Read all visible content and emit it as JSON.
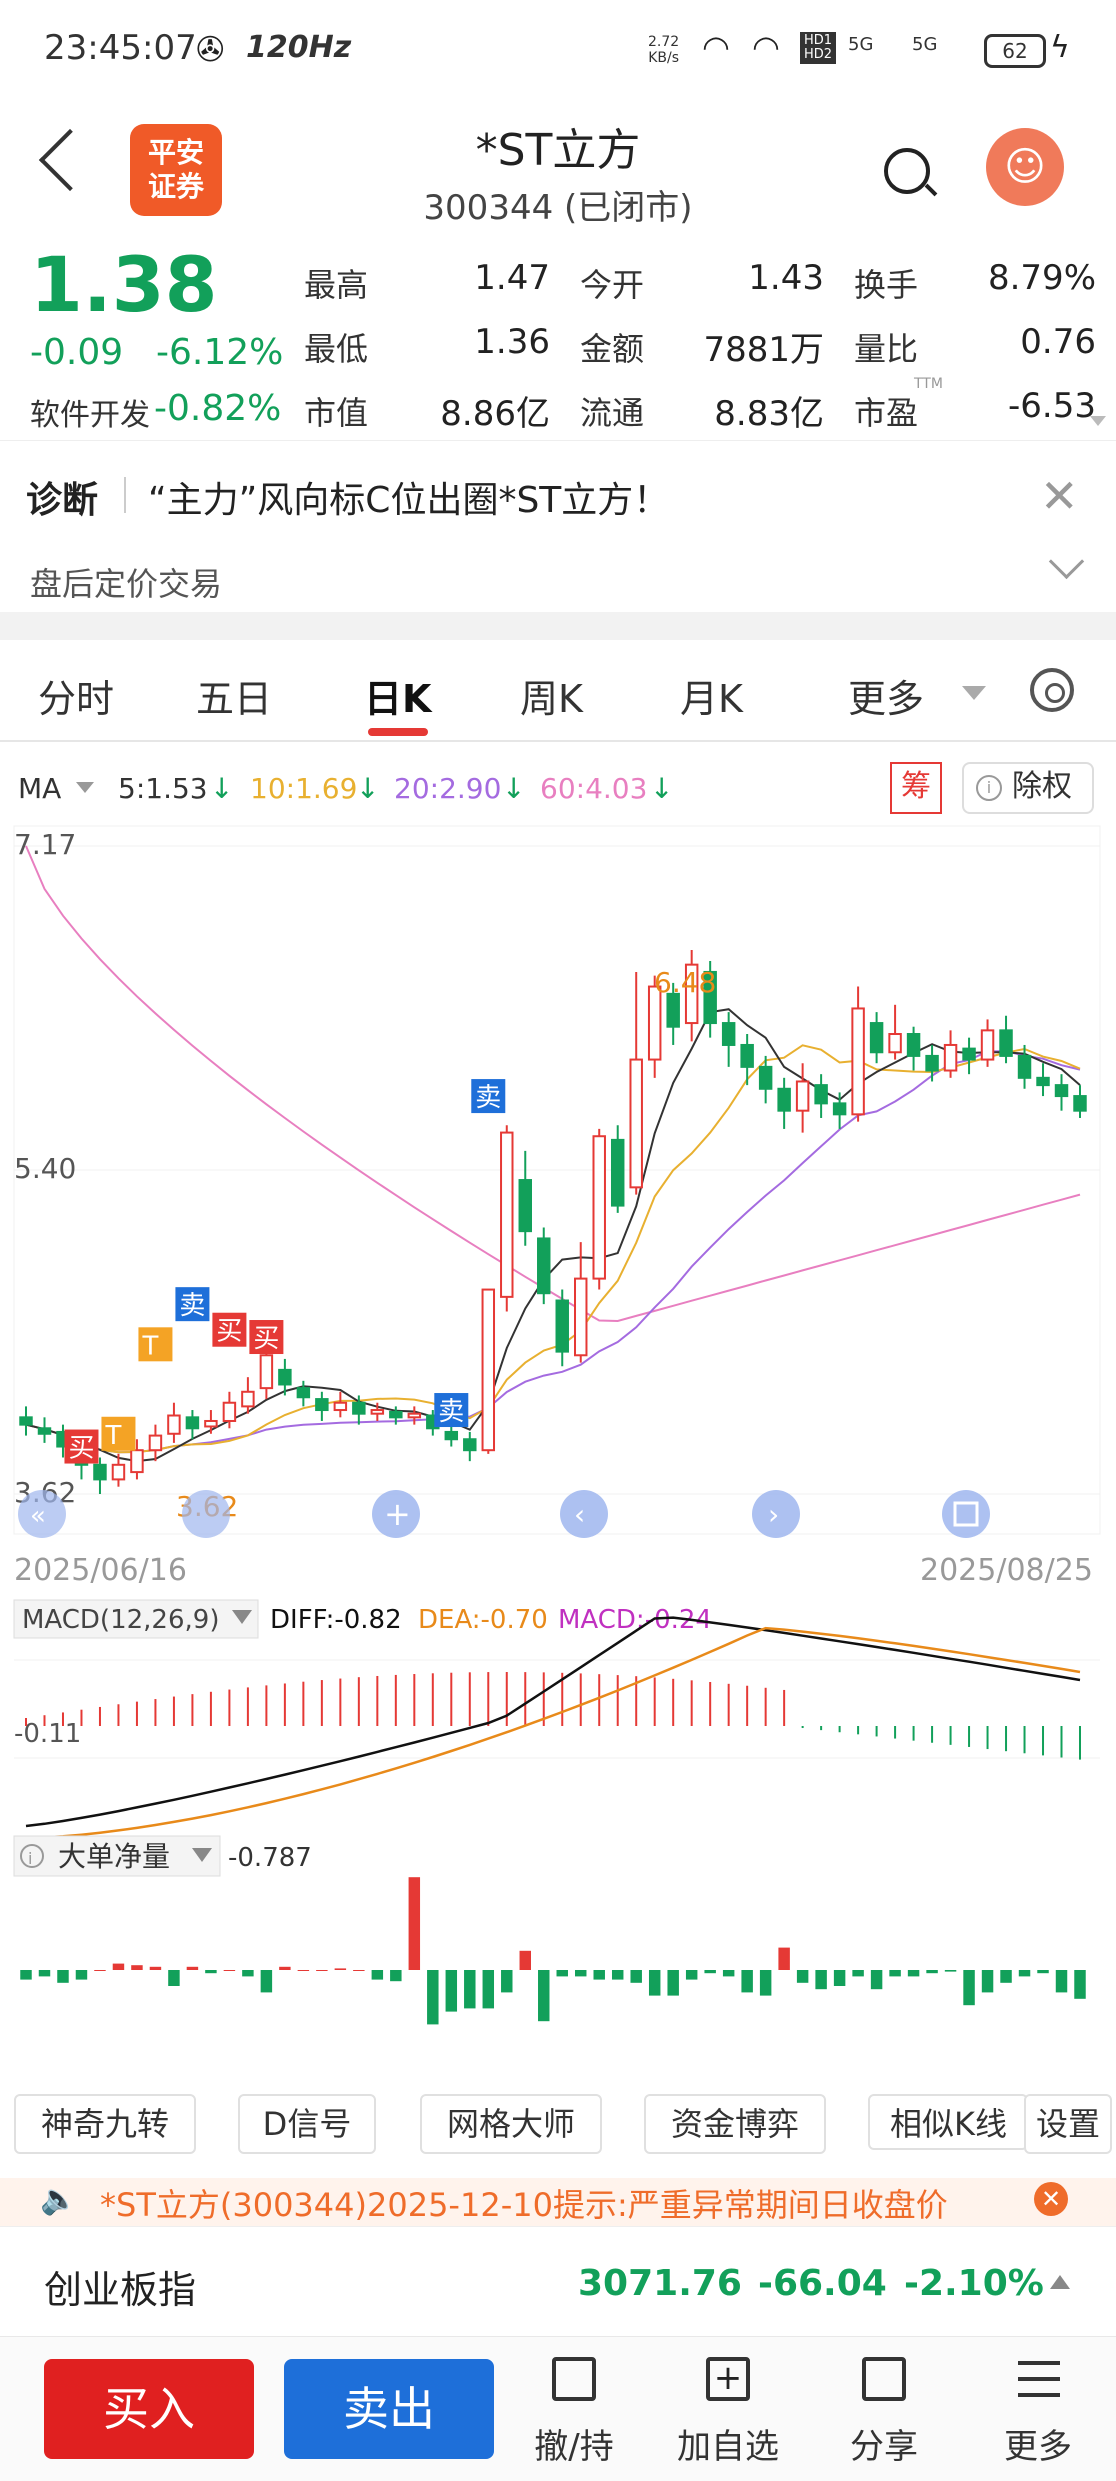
{
  "status_bar": {
    "time": "23:45:07",
    "refresh_rate": "120Hz",
    "net_speed": "2.72",
    "net_unit": "KB/s",
    "hd1": "HD1",
    "hd2": "HD2",
    "sig1": "5G",
    "sig2": "5G",
    "battery": "62"
  },
  "header": {
    "logo_line1": "平安",
    "logo_line2": "证券",
    "title": "*ST立方",
    "code": "300344 (已闭市)"
  },
  "quote": {
    "price": "1.38",
    "change": "-0.09",
    "change_pct": "-6.12%",
    "sector": "软件开发",
    "sector_pct": "-0.82%",
    "items": [
      {
        "label": "最高",
        "value": "1.47"
      },
      {
        "label": "今开",
        "value": "1.43"
      },
      {
        "label": "换手",
        "value": "8.79%"
      },
      {
        "label": "最低",
        "value": "1.36"
      },
      {
        "label": "金额",
        "value": "7881万"
      },
      {
        "label": "量比",
        "value": "0.76"
      },
      {
        "label": "市值",
        "value": "8.86亿"
      },
      {
        "label": "流通",
        "value": "8.83亿"
      },
      {
        "label": "市盈",
        "value": "-6.53"
      }
    ],
    "ttm": "TTM"
  },
  "diag": {
    "tag": "诊断",
    "text": "“主力”风向标C位出圈*ST立方！",
    "sub": "盘后定价交易"
  },
  "tabs": [
    "分时",
    "五日",
    "日K",
    "周K",
    "月K",
    "更多"
  ],
  "ma_legend": {
    "label": "MA",
    "ma5": "5:1.53",
    "ma10": "10:1.69",
    "ma20": "20:2.90",
    "ma60": "60:4.03",
    "chou": "筹",
    "chuquan": "除权"
  },
  "colors": {
    "up": "#e53935",
    "down": "#12a05a",
    "ma5": "#333333",
    "ma10": "#e8b030",
    "ma20": "#a46be0",
    "ma60": "#e87fc0",
    "buy": "#e53935",
    "sell": "#1e6fd9",
    "diff": "#111111",
    "dea": "#e88a1a",
    "macd": "#c030c0"
  },
  "kchart": {
    "y_high_label": "7.17",
    "y_mid_label": "5.40",
    "y_low_label": "3.62",
    "max_label": "6.48",
    "min_label": "3.62",
    "start_date": "2025/06/16",
    "end_date": "2025/08/25",
    "marks": {
      "buy": "买",
      "sell": "卖",
      "t": "T"
    }
  },
  "macd": {
    "label": "MACD(12,26,9)",
    "diff": "DIFF:-0.82",
    "dea": "DEA:-0.70",
    "macd": "MACD:-0.24",
    "axis": "-0.11"
  },
  "big_order": {
    "label": "大单净量",
    "value": "-0.787"
  },
  "tools": [
    "神奇九转",
    "D信号",
    "网格大师",
    "资金博弈",
    "相似K线",
    "设置"
  ],
  "notice": "*ST立方(300344)2025-12-10提示:严重异常期间日收盘价",
  "index": {
    "name": "创业板指",
    "value": "3071.76",
    "change": "-66.04",
    "pct": "-2.10%"
  },
  "bottom": {
    "buy": "买入",
    "sell": "卖出",
    "cancel": "撤/持",
    "add": "加自选",
    "share": "分享",
    "more": "更多"
  },
  "chart_data": {
    "type": "candlestick",
    "start": "2025/06/16",
    "end": "2025/08/25",
    "y_labels": [
      7.17,
      5.4,
      3.62
    ],
    "candles": [
      [
        4.04,
        4.0,
        4.1,
        3.94
      ],
      [
        3.98,
        3.95,
        4.04,
        3.9
      ],
      [
        3.96,
        3.88,
        4.0,
        3.82
      ],
      [
        3.85,
        3.78,
        3.9,
        3.7
      ],
      [
        3.78,
        3.7,
        3.82,
        3.62
      ],
      [
        3.7,
        3.78,
        3.84,
        3.66
      ],
      [
        3.74,
        3.86,
        3.92,
        3.7
      ],
      [
        3.86,
        3.94,
        4.0,
        3.8
      ],
      [
        3.95,
        4.05,
        4.12,
        3.9
      ],
      [
        4.04,
        3.98,
        4.08,
        3.92
      ],
      [
        3.99,
        4.02,
        4.08,
        3.95
      ],
      [
        4.02,
        4.12,
        4.18,
        3.98
      ],
      [
        4.1,
        4.18,
        4.26,
        4.06
      ],
      [
        4.2,
        4.38,
        4.45,
        4.14
      ],
      [
        4.3,
        4.22,
        4.36,
        4.16
      ],
      [
        4.2,
        4.15,
        4.24,
        4.1
      ],
      [
        4.14,
        4.08,
        4.18,
        4.02
      ],
      [
        4.08,
        4.12,
        4.18,
        4.04
      ],
      [
        4.12,
        4.06,
        4.16,
        4.0
      ],
      [
        4.06,
        4.08,
        4.12,
        4.02
      ],
      [
        4.07,
        4.04,
        4.1,
        4.0
      ],
      [
        4.04,
        4.06,
        4.1,
        4.0
      ],
      [
        4.05,
        3.98,
        4.08,
        3.94
      ],
      [
        3.96,
        3.92,
        4.0,
        3.88
      ],
      [
        3.92,
        3.86,
        3.96,
        3.8
      ],
      [
        3.86,
        4.74,
        4.74,
        3.84
      ],
      [
        4.7,
        5.6,
        5.64,
        4.62
      ],
      [
        5.34,
        5.06,
        5.5,
        4.98
      ],
      [
        5.02,
        4.72,
        5.08,
        4.66
      ],
      [
        4.68,
        4.4,
        4.74,
        4.32
      ],
      [
        4.38,
        4.8,
        5.0,
        4.34
      ],
      [
        4.8,
        5.58,
        5.62,
        4.74
      ],
      [
        5.56,
        5.2,
        5.64,
        5.16
      ],
      [
        5.3,
        6.0,
        6.48,
        5.26
      ],
      [
        6.0,
        6.4,
        6.46,
        5.9
      ],
      [
        6.36,
        6.18,
        6.42,
        6.08
      ],
      [
        6.2,
        6.52,
        6.6,
        6.1
      ],
      [
        6.48,
        6.2,
        6.54,
        6.12
      ],
      [
        6.2,
        6.08,
        6.26,
        5.96
      ],
      [
        6.08,
        5.96,
        6.14,
        5.86
      ],
      [
        5.96,
        5.84,
        6.02,
        5.76
      ],
      [
        5.84,
        5.72,
        5.9,
        5.62
      ],
      [
        5.72,
        5.88,
        5.98,
        5.6
      ],
      [
        5.86,
        5.76,
        5.92,
        5.68
      ],
      [
        5.76,
        5.7,
        5.82,
        5.62
      ],
      [
        5.7,
        6.28,
        6.4,
        5.66
      ],
      [
        6.2,
        6.04,
        6.26,
        5.98
      ],
      [
        6.04,
        6.14,
        6.3,
        6.0
      ],
      [
        6.14,
        6.02,
        6.18,
        5.94
      ],
      [
        6.02,
        5.94,
        6.08,
        5.88
      ],
      [
        5.94,
        6.08,
        6.16,
        5.9
      ],
      [
        6.06,
        6.0,
        6.12,
        5.92
      ],
      [
        6.0,
        6.16,
        6.22,
        5.96
      ],
      [
        6.16,
        6.02,
        6.24,
        5.98
      ],
      [
        6.02,
        5.9,
        6.08,
        5.84
      ],
      [
        5.9,
        5.86,
        5.98,
        5.8
      ],
      [
        5.86,
        5.8,
        5.92,
        5.72
      ],
      [
        5.8,
        5.72,
        5.86,
        5.68
      ]
    ]
  }
}
